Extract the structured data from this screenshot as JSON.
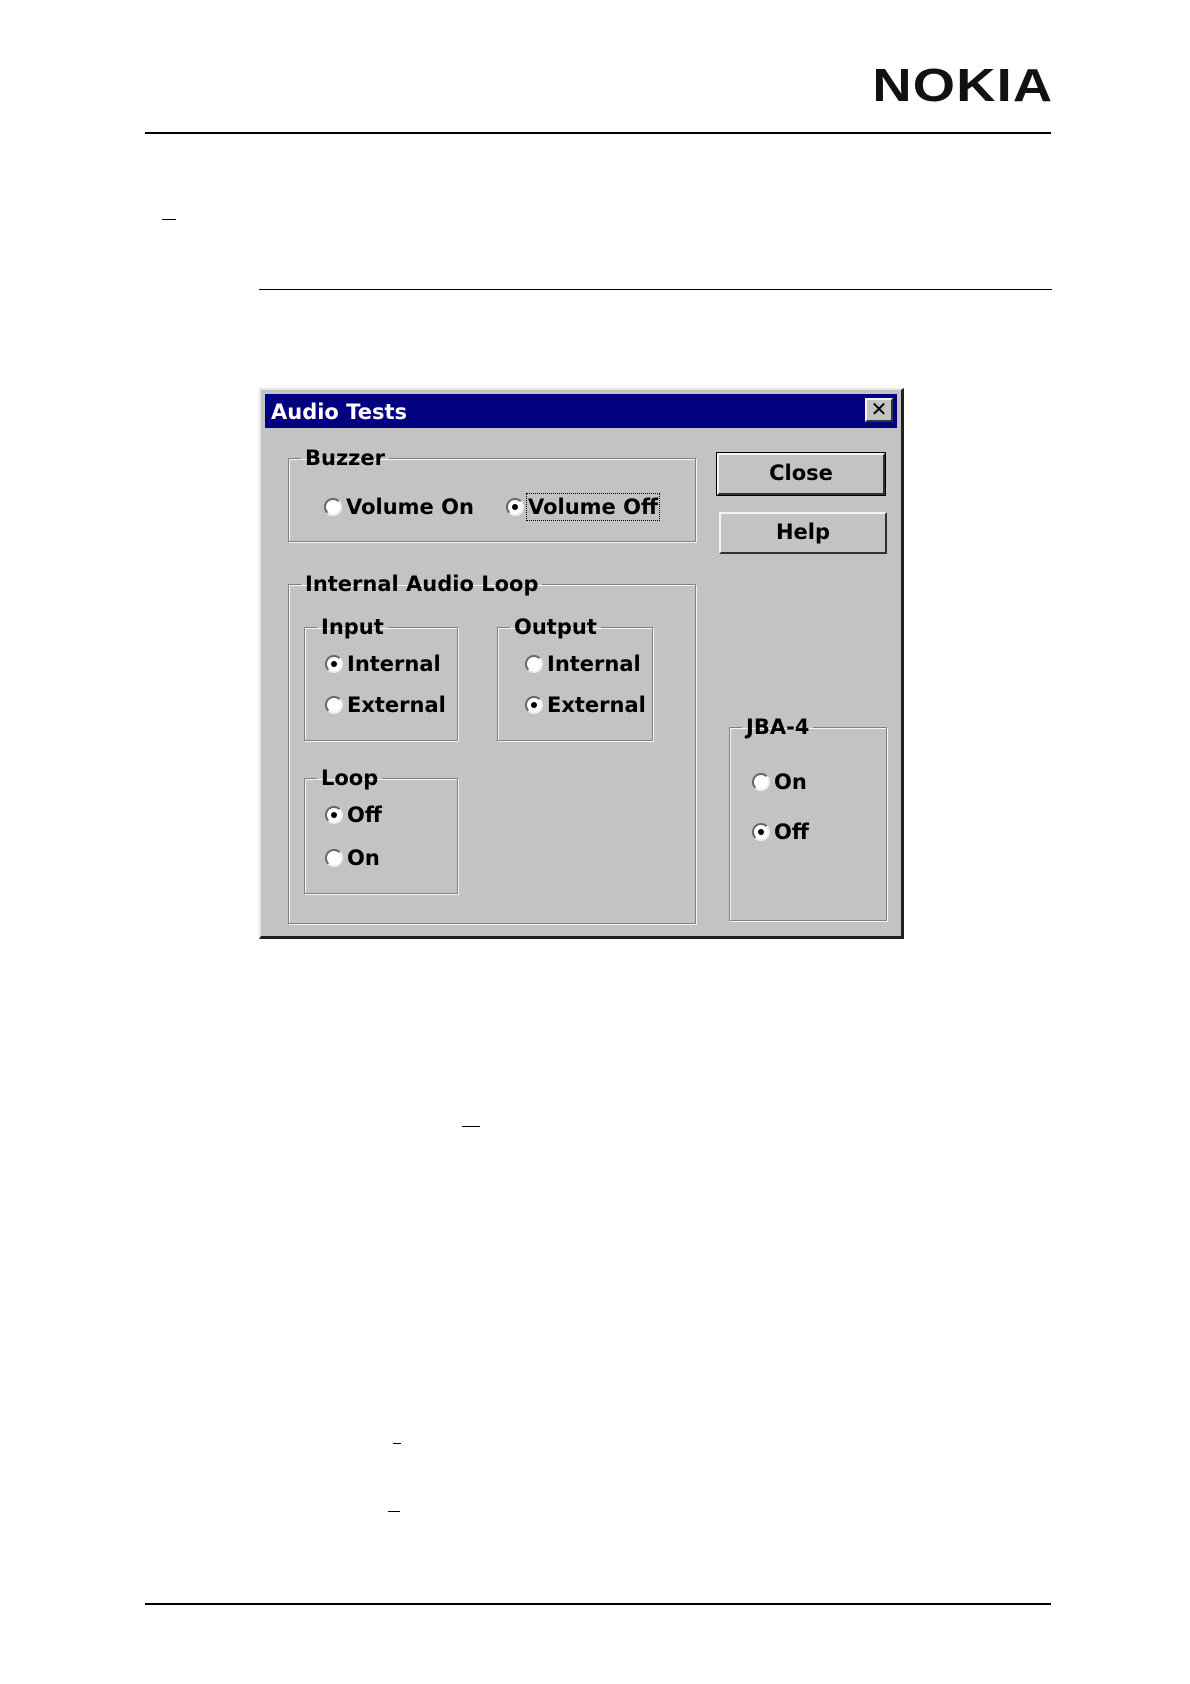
{
  "header": {
    "logo": "NOKIA"
  },
  "dialog": {
    "title": "Audio Tests",
    "close_glyph": "✕",
    "buttons": {
      "close": "Close",
      "help": "Help"
    },
    "buzzer": {
      "label": "Buzzer",
      "options": [
        {
          "label": "Volume On",
          "selected": false
        },
        {
          "label": "Volume Off",
          "selected": true
        }
      ]
    },
    "internal_audio_loop": {
      "label": "Internal Audio Loop",
      "input": {
        "label": "Input",
        "options": [
          {
            "label": "Internal",
            "selected": true
          },
          {
            "label": "External",
            "selected": false
          }
        ]
      },
      "output": {
        "label": "Output",
        "options": [
          {
            "label": "Internal",
            "selected": false
          },
          {
            "label": "External",
            "selected": true
          }
        ]
      },
      "loop": {
        "label": "Loop",
        "options": [
          {
            "label": "Off",
            "selected": true
          },
          {
            "label": "On",
            "selected": false
          }
        ]
      }
    },
    "jba4": {
      "label": "JBA-4",
      "options": [
        {
          "label": "On",
          "selected": false
        },
        {
          "label": "Off",
          "selected": true
        }
      ]
    }
  }
}
